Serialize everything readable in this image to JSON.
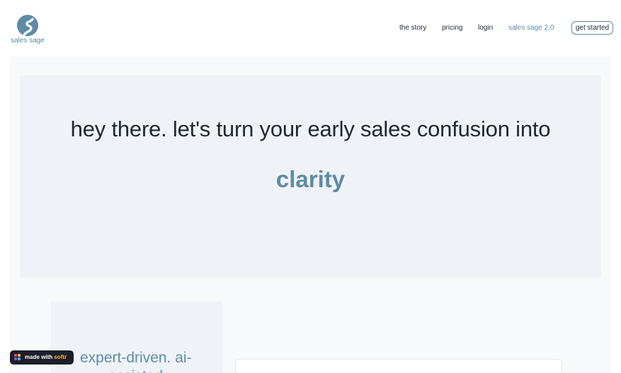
{
  "colors": {
    "accent": "#5f8ca3",
    "hero_bg": "#eff3f7",
    "page_bg": "#f7f9fb",
    "badge_bg": "#1e1e2a",
    "badge_brand": "#f5b83d"
  },
  "header": {
    "logo_icon": "winding-road-logo-icon",
    "logo_text": "sales sage",
    "nav": {
      "story": "the story",
      "pricing": "pricing",
      "login": "login",
      "sage": "sales sage 2.0"
    },
    "cta": "get started"
  },
  "hero": {
    "heading": "hey there. let's turn your early sales confusion into",
    "accent": "clarity"
  },
  "feature": {
    "line1": "expert-driven. ai-",
    "line2": "assisted."
  },
  "badge": {
    "prefix": "made with",
    "brand": "softr"
  }
}
